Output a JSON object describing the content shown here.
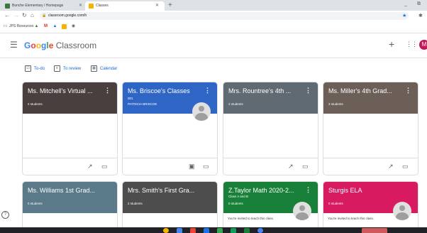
{
  "browser": {
    "tabs": [
      {
        "title": "Bunche Elementary / Homepage",
        "favicon_color": "#3c7a3c",
        "active": false
      },
      {
        "title": "Classes",
        "favicon_color": "#f4b400",
        "active": true
      }
    ],
    "new_tab_icon": "plus-icon",
    "url": "classroom.google.com/h",
    "bookmarks": [
      {
        "label": "JPS Resources",
        "icon": "folder-icon"
      }
    ],
    "bookmark_icons": [
      "school-icon",
      "gmail-icon",
      "drive-icon",
      "classroom-icon",
      "chrome-icon"
    ]
  },
  "app": {
    "brand_google": "Google",
    "brand_product": "Classroom",
    "avatar_initial": "M",
    "avatar_color": "#c2185b"
  },
  "links": {
    "todo": "To-do",
    "to_review": "To review",
    "calendar": "Calendar"
  },
  "classes": [
    {
      "name": "Ms. Mitchell's Virtual ...",
      "section": "",
      "subtitle": "2 students",
      "color": "#4a3f3f",
      "has_owner": false,
      "invite": ""
    },
    {
      "name": "Ms. Briscoe's Classes",
      "section": "001",
      "subtitle": "PATRICIA BRISCOE",
      "color": "#2f66c6",
      "has_owner": true,
      "invite": ""
    },
    {
      "name": "Mrs. Rountree's 4th ...",
      "section": "",
      "subtitle": "2 students",
      "color": "#5f6a72",
      "has_owner": false,
      "invite": ""
    },
    {
      "name": "Ms. Miller's 4th Grad...",
      "section": "",
      "subtitle": "3 students",
      "color": "#6b5f58",
      "has_owner": false,
      "invite": ""
    },
    {
      "name": "Ms. Williams 1st Grad...",
      "section": "",
      "subtitle": "0 students",
      "color": "#5a7a8a",
      "has_owner": false,
      "invite": ""
    },
    {
      "name": "Mrs. Smith's First Gra...",
      "section": "",
      "subtitle": "2 students",
      "color": "#4d4d4d",
      "has_owner": false,
      "invite": ""
    },
    {
      "name": "Z.Taylor Math 2020-2...",
      "section": "Class A and B",
      "subtitle": "0 students",
      "color": "#188038",
      "has_owner": true,
      "invite": "You're invited to teach this class."
    },
    {
      "name": "Sturgis ELA",
      "section": "",
      "subtitle": "0 students",
      "color": "#d81b60",
      "has_owner": true,
      "invite": "You're invited to teach this class."
    }
  ]
}
